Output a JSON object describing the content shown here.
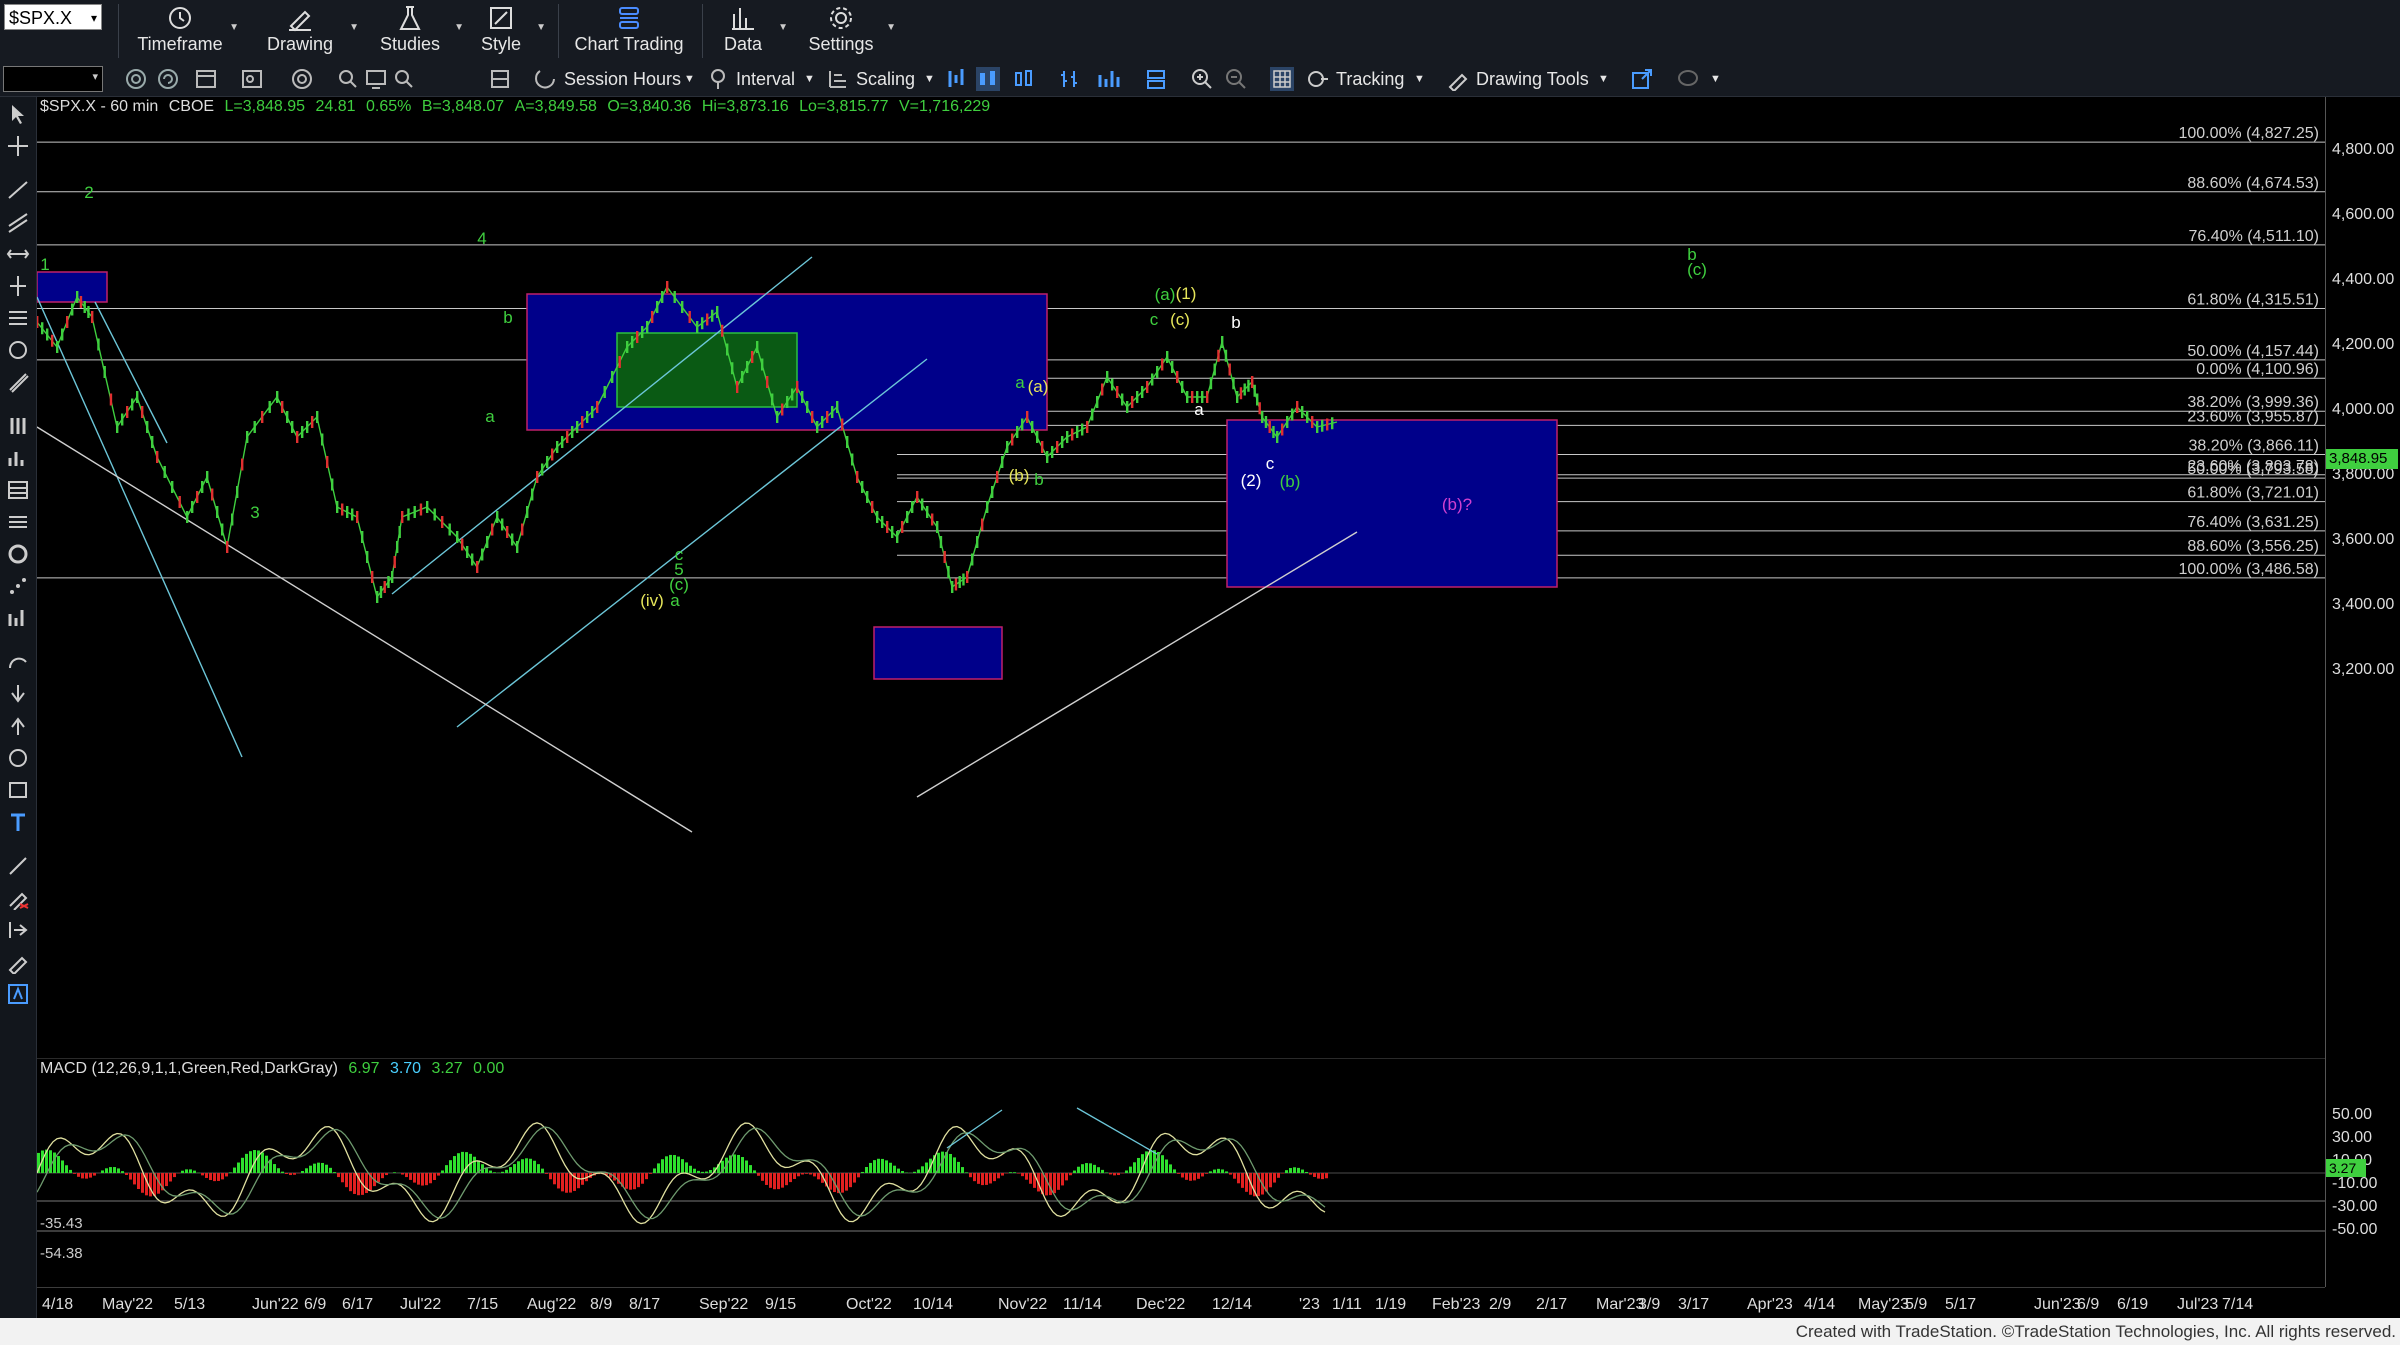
{
  "toolbar": {
    "symbol": "$SPX.X",
    "buttons": [
      "Timeframe",
      "Drawing",
      "Studies",
      "Style",
      "Chart Trading",
      "Data",
      "Settings"
    ],
    "session_hours": "Session Hours",
    "interval": "Interval",
    "scaling": "Scaling",
    "tracking": "Tracking",
    "drawing_tools": "Drawing Tools"
  },
  "info": {
    "symbol": "$SPX.X - 60 min",
    "exchange": "CBOE",
    "last": "L=3,848.95",
    "change": "24.81",
    "pct": "0.65%",
    "bid": "B=3,848.07",
    "ask": "A=3,849.58",
    "open": "O=3,840.36",
    "high": "Hi=3,873.16",
    "low": "Lo=3,815.77",
    "volume": "V=1,716,229"
  },
  "macd": {
    "label": "MACD (12,26,9,1,1,Green,Red,DarkGray)",
    "v1": "6.97",
    "v2": "3.70",
    "v3": "3.27",
    "v4": "0.00",
    "level_labels": [
      "-35.43",
      "-54.38"
    ],
    "axis": [
      "50.00",
      "30.00",
      "10.00",
      "-10.00",
      "-30.00",
      "-50.00"
    ],
    "current": "3.27"
  },
  "price_axis": {
    "ticks": [
      "4,800.00",
      "4,600.00",
      "4,400.00",
      "4,200.00",
      "4,000.00",
      "3,800.00",
      "3,600.00",
      "3,400.00",
      "3,200.00"
    ],
    "current_price": "3,848.95"
  },
  "x_axis": [
    "4/18",
    "May'22",
    "5/13",
    "Jun'22",
    "6/9",
    "6/17",
    "Jul'22",
    "7/15",
    "Aug'22",
    "8/9",
    "8/17",
    "Sep'22",
    "9/15",
    "Oct'22",
    "10/14",
    "Nov'22",
    "11/14",
    "Dec'22",
    "12/14",
    "'23",
    "1/11",
    "1/19",
    "Feb'23",
    "2/9",
    "2/17",
    "Mar'23",
    "3/9",
    "3/17",
    "Apr'23",
    "4/14",
    "May'23",
    "5/9",
    "5/17",
    "Jun'23",
    "6/9",
    "6/19",
    "Jul'23",
    "7/14"
  ],
  "fib_levels": [
    {
      "label": "100.00% (4,827.25)",
      "price": 4827.25,
      "color": "#c8c8c8"
    },
    {
      "label": "88.60% (4,674.53)",
      "price": 4674.53,
      "color": "#c8c8c8"
    },
    {
      "label": "76.40% (4,511.10)",
      "price": 4511.1,
      "color": "#c8c8c8"
    },
    {
      "label": "61.80% (4,315.51)",
      "price": 4315.51,
      "color": "#c8c8c8"
    },
    {
      "label": "50.00% (4,157.44)",
      "price": 4157.44,
      "color": "#c8c8c8"
    },
    {
      "label": "0.00% (4,100.96)",
      "price": 4100.96,
      "color": "#c8c8c8"
    },
    {
      "label": "38.20% (3,999.36)",
      "price": 3999.36,
      "color": "#c8c8c8"
    },
    {
      "label": "23.60% (3,955.87)",
      "price": 3955.87,
      "color": "#c8c8c8"
    },
    {
      "label": "38.20% (3,866.11)",
      "price": 3866.11,
      "color": "#c8c8c8"
    },
    {
      "label": "23.60% (3,803.78)",
      "price": 3803.78,
      "color": "#c8c8c8"
    },
    {
      "label": "50.00% (3,793.58)",
      "price": 3793.58,
      "color": "#c8c8c8"
    },
    {
      "label": "61.80% (3,721.01)",
      "price": 3721.01,
      "color": "#c8c8c8"
    },
    {
      "label": "76.40% (3,631.25)",
      "price": 3631.25,
      "color": "#c8c8c8"
    },
    {
      "label": "88.60% (3,556.25)",
      "price": 3556.25,
      "color": "#c8c8c8"
    },
    {
      "label": "100.00% (3,486.58)",
      "price": 3486.58,
      "color": "#c8c8c8"
    }
  ],
  "wave_labels": [
    {
      "text": "1",
      "color": "#3fcf3f"
    },
    {
      "text": "2",
      "color": "#3fcf3f"
    },
    {
      "text": "3",
      "color": "#3fcf3f"
    },
    {
      "text": "4",
      "color": "#3fcf3f"
    },
    {
      "text": "b",
      "color": "#3fcf3f"
    },
    {
      "text": "a",
      "color": "#3fcf3f"
    },
    {
      "text": "c",
      "color": "#3fcf3f"
    },
    {
      "text": "5",
      "color": "#3fcf3f"
    },
    {
      "text": "(c)",
      "color": "#3fcf3f"
    },
    {
      "text": "(iv)",
      "color": "#e6e65a"
    },
    {
      "text": "a",
      "color": "#3fcf3f"
    },
    {
      "text": "a",
      "color": "#3fcf3f"
    },
    {
      "text": "(a)",
      "color": "#e6e65a"
    },
    {
      "text": "(b)",
      "color": "#e6e65a"
    },
    {
      "text": "b",
      "color": "#3fcf3f"
    },
    {
      "text": "(a)",
      "color": "#3fcf3f"
    },
    {
      "text": "(1)",
      "color": "#e6e65a"
    },
    {
      "text": "c",
      "color": "#3fcf3f"
    },
    {
      "text": "(c)",
      "color": "#e6e65a"
    },
    {
      "text": "b",
      "color": "#ffffff"
    },
    {
      "text": "a",
      "color": "#ffffff"
    },
    {
      "text": "c",
      "color": "#ffffff"
    },
    {
      "text": "(2)",
      "color": "#ffffff"
    },
    {
      "text": "(b)",
      "color": "#3fcf3f"
    },
    {
      "text": "(b)?",
      "color": "#d040d0"
    },
    {
      "text": "b",
      "color": "#3fcf3f"
    },
    {
      "text": "(c)",
      "color": "#3fcf3f"
    }
  ],
  "footer": "Created with TradeStation. ©TradeStation Technologies, Inc. All rights reserved."
}
